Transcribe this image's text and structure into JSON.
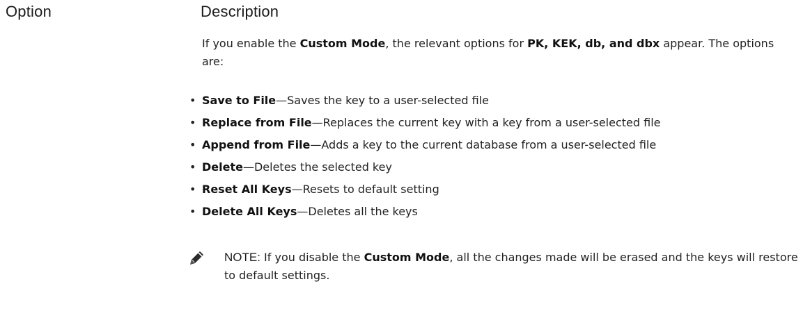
{
  "table": {
    "headers": {
      "option": "Option",
      "description": "Description"
    }
  },
  "intro": {
    "text1": "If you enable the ",
    "bold1": "Custom Mode",
    "text2": ", the relevant options for ",
    "bold2": "PK, KEK, db, and dbx",
    "text3": " appear. The options are:"
  },
  "bullets": [
    {
      "name": "Save to File",
      "desc": "—Saves the key to a user-selected file"
    },
    {
      "name": "Replace from File",
      "desc": "—Replaces the current key with a key from a user-selected file"
    },
    {
      "name": "Append from File",
      "desc": "—Adds a key to the current database from a user-selected file"
    },
    {
      "name": "Delete",
      "desc": "—Deletes the selected key"
    },
    {
      "name": "Reset All Keys",
      "desc": "—Resets to default setting"
    },
    {
      "name": "Delete All Keys",
      "desc": "—Deletes all the keys"
    }
  ],
  "note": {
    "icon": "pencil-note-icon",
    "label": "NOTE:",
    "text1": " If you disable the ",
    "bold": "Custom Mode",
    "text2": ", all the changes made will be erased and the keys will restore to default settings."
  }
}
